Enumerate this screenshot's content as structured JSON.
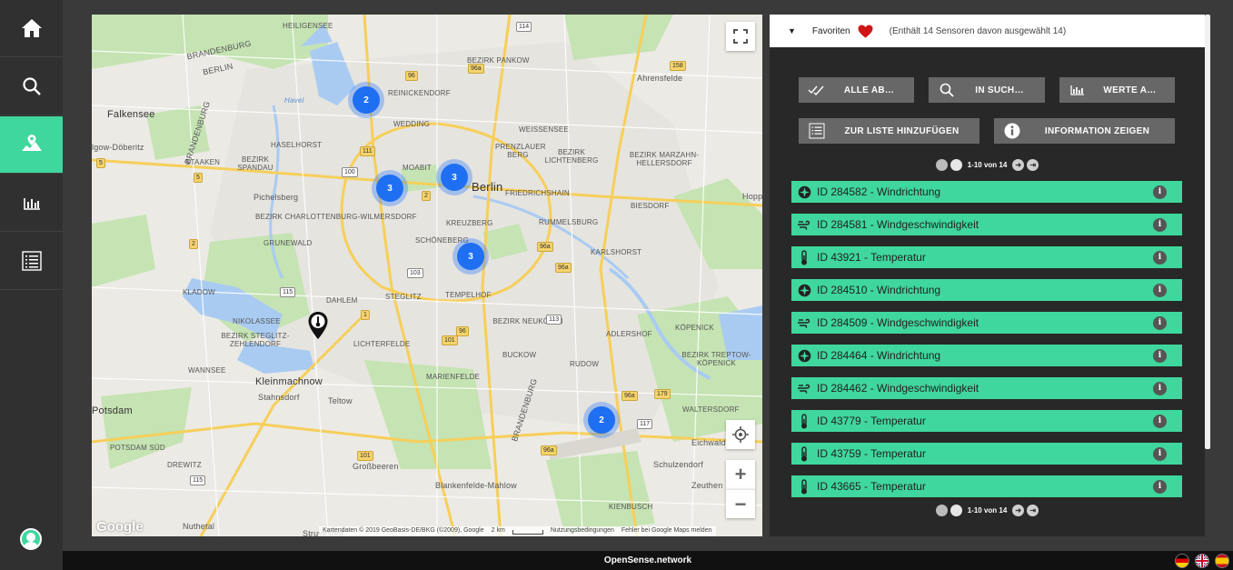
{
  "sidebar": {
    "items": [
      {
        "name": "home",
        "icon": "home-icon"
      },
      {
        "name": "search",
        "icon": "search-icon"
      },
      {
        "name": "map",
        "icon": "map-icon",
        "active": true
      },
      {
        "name": "charts",
        "icon": "bar-chart-icon"
      },
      {
        "name": "list",
        "icon": "list-icon"
      }
    ],
    "user_icon": "user-avatar-icon"
  },
  "map": {
    "labels": {
      "berlin": "Berlin",
      "falkensee": "Falkensee",
      "potsdam": "Potsdam",
      "kleinmachnow": "Kleinmachnow",
      "teltow": "Teltow",
      "stahnsdorf": "Stahnsdorf",
      "grossbeeren": "Großbeeren",
      "blankenfelde": "Blankenfelde-Mahlow",
      "schulzendorf": "Schulzendorf",
      "eichwalde": "Eichwalde",
      "zeuthen": "Zeuthen",
      "nuthetal": "Nuthetal",
      "ahrensfelde": "Ahrensfelde",
      "pichelsberg": "Pichelsberg",
      "hoppegarten": "Hoppe",
      "wedding": "WEDDING",
      "moabit": "MOABIT",
      "kreuzberg": "KREUZBERG",
      "schoeneberg": "SCHÖNEBERG",
      "tempelhof": "TEMPELHOF",
      "steglitz": "STEGLITZ",
      "dahlem": "DAHLEM",
      "zehlendorf": "ZEHLENDORF",
      "lichterfelde": "LICHTERFELDE",
      "marienfelde": "MARIENFELDE",
      "neukoelln": "BEZIRK NEUKÖLLN",
      "friedrichshain": "FRIEDRICHSHAIN",
      "rummelsburg": "RUMMELSBURG",
      "karlshorst": "KARLSHORST",
      "koepenick": "KÖPENICK",
      "adlershof": "ADLERSHOF",
      "rudow": "RUDOW",
      "buckow": "BUCKOW",
      "lichtenberg": "BEZIRK LICHTENBERG",
      "pankow": "BEZIRK PANKOW",
      "weissensee": "WEISSENSEE",
      "prenzlauer": "PRENZLAUER BERG",
      "marzahn": "BEZIRK MARZAHN-HELLERSDORF",
      "reinickendorf": "REINICKENDORF",
      "spandau": "BEZIRK SPANDAU",
      "haselhorst": "HASELHORST",
      "staaken": "STAAKEN",
      "charlottenburg": "BEZIRK CHARLOTTENBURG-WILMERSDORF",
      "grunewald": "GRUNEWALD",
      "kladow": "KLADOW",
      "nikolassee": "NIKOLASSEE",
      "steglitz_zehlendorf": "BEZIRK STEGLITZ-ZEHLENDORF",
      "wannsee": "WANNSEE",
      "drewitz": "DREWITZ",
      "potsdam_sued": "POTSDAM SÜD",
      "biesdorf": "BIESDORF",
      "heiligensee": "HEILIGENSEE",
      "treptow_koepenick": "BEZIRK TREPTOW-KÖPENICK",
      "brandenburg1": "BRANDENBURG",
      "brandenburg2": "BRANDENBURG",
      "brandenburg3": "BRANDENBURG",
      "berlin_state": "BERLIN",
      "waltersdorf": "WALTERSDORF",
      "kienbusch": "KIENBUSCH",
      "stahnsdorf2": "Struveshof",
      "havel": "Havel",
      "glw": "lgow-Döberitz"
    },
    "clusters": [
      {
        "count": "2"
      },
      {
        "count": "3"
      },
      {
        "count": "3"
      },
      {
        "count": "3"
      },
      {
        "count": "2"
      }
    ],
    "google": "Google",
    "attribution": {
      "data": "Kartendaten © 2019 GeoBasis-DE/BKG (©2009), Google",
      "scale": "2 km",
      "terms": "Nutzungsbedingungen",
      "report": "Fehler bei Google Maps melden"
    },
    "zoom_in": "+",
    "zoom_out": "−"
  },
  "panel": {
    "header": {
      "title": "Favoriten",
      "info": "(Enthält 14 Sensoren davon ausgewählt 14)",
      "heart_color": "#d11515"
    },
    "buttons": [
      {
        "label": "ALLE AB…",
        "icon": "double-check-icon"
      },
      {
        "label": "IN SUCH…",
        "icon": "search-icon"
      },
      {
        "label": "WERTE A…",
        "icon": "bar-chart-icon"
      },
      {
        "label": "ZUR LISTE HINZUFÜGEN",
        "icon": "list-icon"
      },
      {
        "label": "INFORMATION ZEIGEN",
        "icon": "info-icon"
      }
    ],
    "pager_text": "1-10 von 14",
    "sensors": [
      {
        "label": "ID 284582 - Windrichtung",
        "icon": "compass-icon"
      },
      {
        "label": "ID 284581 - Windgeschwindigkeit",
        "icon": "wind-icon"
      },
      {
        "label": "ID 43921 - Temperatur",
        "icon": "thermometer-icon"
      },
      {
        "label": "ID 284510 - Windrichtung",
        "icon": "compass-icon"
      },
      {
        "label": "ID 284509 - Windgeschwindigkeit",
        "icon": "wind-icon"
      },
      {
        "label": "ID 284464 - Windrichtung",
        "icon": "compass-icon"
      },
      {
        "label": "ID 284462 - Windgeschwindigkeit",
        "icon": "wind-icon"
      },
      {
        "label": "ID 43779 - Temperatur",
        "icon": "thermometer-icon"
      },
      {
        "label": "ID 43759 - Temperatur",
        "icon": "thermometer-icon"
      },
      {
        "label": "ID 43665 - Temperatur",
        "icon": "thermometer-icon"
      }
    ],
    "info_glyph": "i"
  },
  "footer": {
    "brand": "OpenSense.network",
    "languages": [
      "de",
      "en",
      "es"
    ]
  },
  "colors": {
    "accent": "#3fd79d",
    "sidebar": "#303030",
    "panel": "#282828",
    "button": "#676767",
    "cluster": "#1f6ff2"
  }
}
